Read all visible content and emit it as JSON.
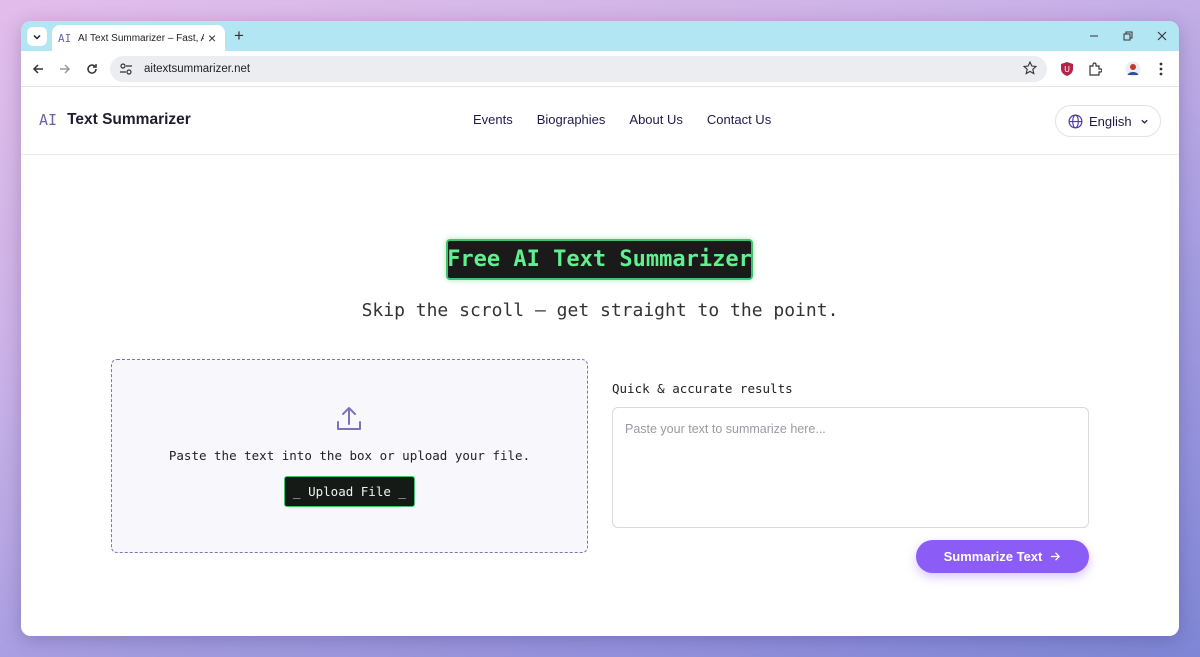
{
  "browser": {
    "tab": {
      "favicon_text": "AI",
      "title": "AI Text Summarizer – Fast, Accu"
    },
    "url": "aitextsummarizer.net"
  },
  "site": {
    "logo_mark": "AI",
    "logo_text": "Text Summarizer",
    "nav": [
      "Events",
      "Biographies",
      "About Us",
      "Contact Us"
    ],
    "language": "English"
  },
  "hero": {
    "title": "Free AI Text Summarizer",
    "subtitle": "Skip the scroll — get straight to the point."
  },
  "dropzone": {
    "instruction": "Paste the text into the box or upload your file.",
    "upload_label": "_ Upload File _"
  },
  "summarizer": {
    "results_label": "Quick & accurate results",
    "placeholder": "Paste your text to summarize here...",
    "button_label": "Summarize Text"
  },
  "icons": {
    "tab_menu": "chevron-down-icon",
    "tab_close": "close-icon",
    "new_tab": "plus-icon",
    "back": "arrow-left-icon",
    "forward": "arrow-right-icon",
    "reload": "reload-icon",
    "site_info": "tune-icon",
    "bookmark": "star-icon",
    "extension_shield": "shield-icon",
    "extensions": "puzzle-icon",
    "profile": "avatar-icon",
    "menu": "kebab-menu-icon",
    "language": "globe-icon",
    "upload": "upload-icon"
  },
  "colors": {
    "accent": "#8b5cf6",
    "terminal_green": "#5ff08f",
    "tab_strip": "#b3e6f3"
  }
}
